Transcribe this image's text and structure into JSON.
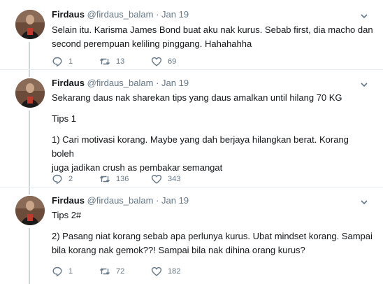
{
  "tweets": [
    {
      "name": "Firdaus",
      "handle": "@firdaus_balam",
      "dot": "·",
      "date": "Jan 19",
      "lines": [
        "Selain itu. Karisma James Bond buat aku nak kurus. Sebab first, dia macho dan",
        "second perempuan keliling pinggang. Hahahahha"
      ],
      "replies": "1",
      "retweets": "13",
      "likes": "69"
    },
    {
      "name": "Firdaus",
      "handle": "@firdaus_balam",
      "dot": "·",
      "date": "Jan 19",
      "lines": [
        "Sekarang daus nak sharekan tips yang daus amalkan until hilang 70 KG",
        "",
        "Tips 1",
        "",
        "1) Cari motivasi korang. Maybe yang dah berjaya hilangkan berat. Korang boleh",
        "juga jadikan crush as pembakar semangat"
      ],
      "replies": "2",
      "retweets": "136",
      "likes": "343"
    },
    {
      "name": "Firdaus",
      "handle": "@firdaus_balam",
      "dot": "·",
      "date": "Jan 19",
      "lines": [
        "Tips 2#",
        "",
        "2) Pasang niat korang sebab apa perlunya kurus. Ubat mindset korang. Sampai",
        "bila korang nak gemok??! Sampai bila nak dihina orang kurus?"
      ],
      "replies": "1",
      "retweets": "72",
      "likes": "182"
    }
  ],
  "icons": {
    "reply": "reply-icon",
    "retweet": "retweet-icon",
    "like": "heart-icon",
    "menu": "chevron-down-icon"
  },
  "colors": {
    "muted": "#657786",
    "text": "#14171a",
    "thread_line": "#ccd6dd",
    "divider": "#e6ecf0"
  }
}
